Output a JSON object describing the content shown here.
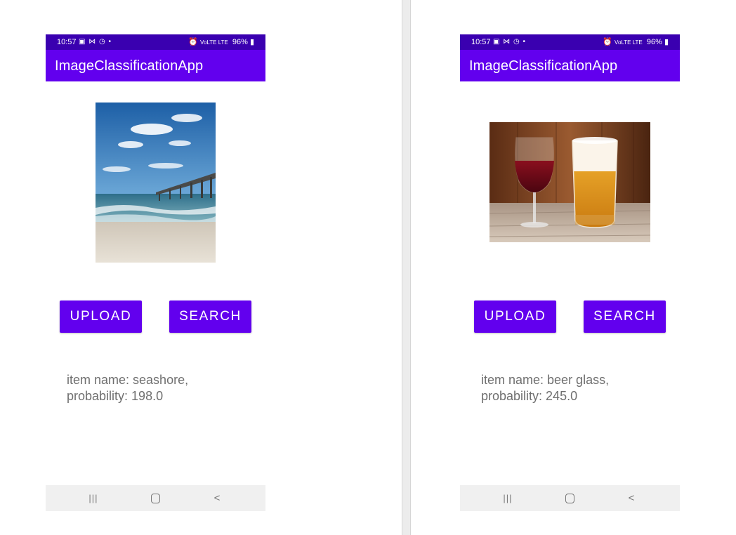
{
  "screens": [
    {
      "status": {
        "time": "10:57",
        "left_icons": "▣ ⋈ ◷ •",
        "signal": "VoLTE LTE",
        "battery": "96%"
      },
      "app_title": "ImageClassificationApp",
      "image_subject": "seashore-pier-photo",
      "buttons": {
        "upload": "UPLOAD",
        "search": "SEARCH"
      },
      "result": {
        "line1": "item name: seashore,",
        "line2": "probability: 198.0"
      },
      "nav": {
        "recent": "|||",
        "home": "home",
        "back": "<"
      }
    },
    {
      "status": {
        "time": "10:57",
        "left_icons": "▣ ⋈ ◷ •",
        "signal": "VoLTE LTE",
        "battery": "96%"
      },
      "app_title": "ImageClassificationApp",
      "image_subject": "wine-and-beer-glasses-photo",
      "buttons": {
        "upload": "UPLOAD",
        "search": "SEARCH"
      },
      "result": {
        "line1": "item name: beer glass,",
        "line2": "probability: 245.0"
      },
      "nav": {
        "recent": "|||",
        "home": "home",
        "back": "<"
      }
    }
  ],
  "colors": {
    "status_bar": "#3a00b0",
    "app_bar": "#6200ee",
    "button": "#6200ee",
    "result_text": "#6f6f6f",
    "nav_bar": "#f0f0f0"
  }
}
